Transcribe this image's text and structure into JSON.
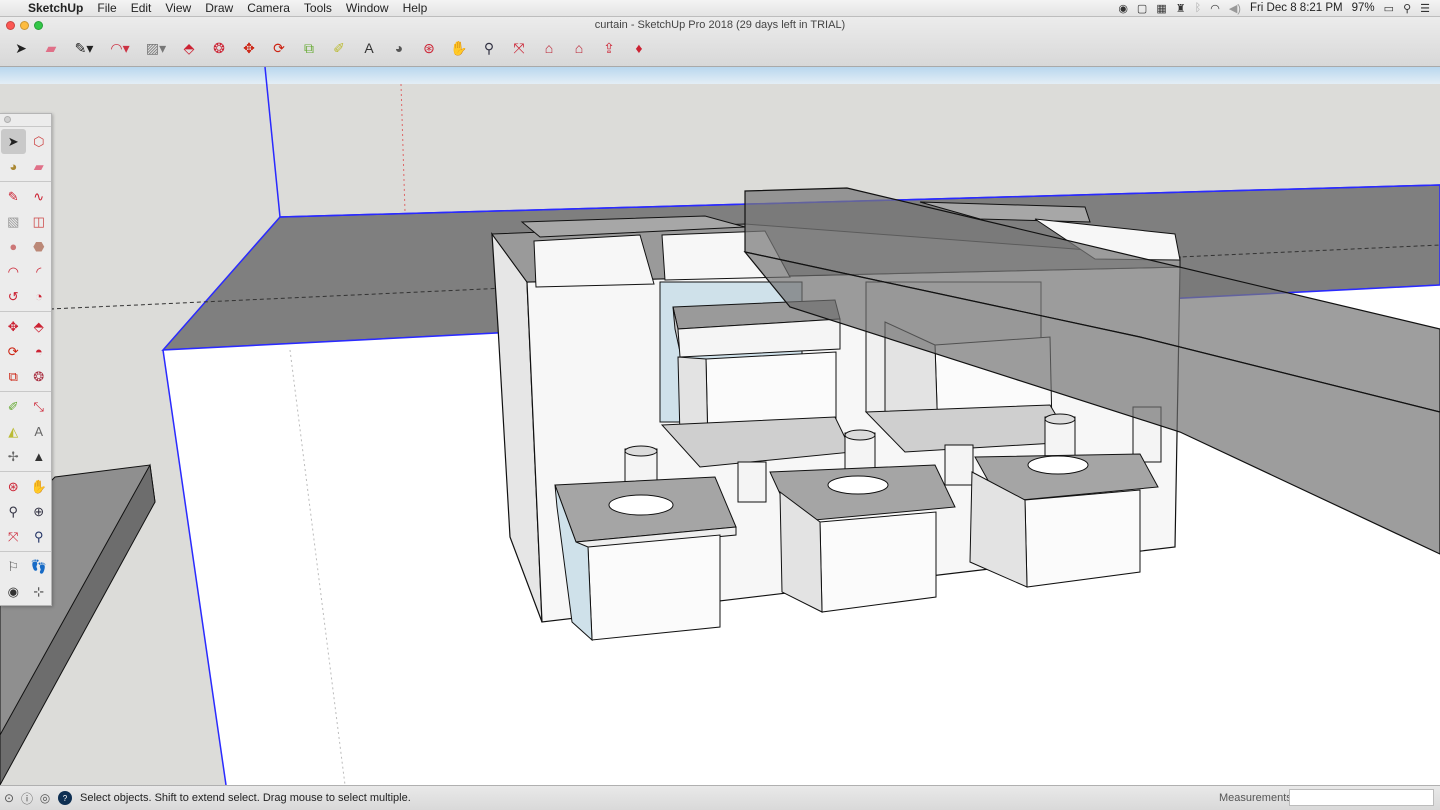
{
  "menubar": {
    "apple": "",
    "app_name": "SketchUp",
    "menus": [
      "File",
      "Edit",
      "View",
      "Draw",
      "Camera",
      "Tools",
      "Window",
      "Help"
    ],
    "status_icons": [
      "camera-icon",
      "screen-icon",
      "grid-icon",
      "binoculars-icon",
      "bluetooth-icon",
      "wifi-icon",
      "volume-icon"
    ],
    "clock": "Fri Dec 8  8:21 PM",
    "battery": "97%"
  },
  "window": {
    "title": "curtain - SketchUp Pro 2018 (29 days left in TRIAL)"
  },
  "toolbar": {
    "tools": [
      {
        "name": "select-tool-icon",
        "glyph": "➤"
      },
      {
        "name": "eraser-tool-icon",
        "glyph": "▰"
      },
      {
        "name": "line-tool-icon",
        "glyph": "✎▾"
      },
      {
        "name": "arc-tool-icon",
        "glyph": "◠▾"
      },
      {
        "name": "shape-tool-icon",
        "glyph": "▨▾"
      },
      {
        "name": "push-pull-tool-icon",
        "glyph": "⬘"
      },
      {
        "name": "offset-tool-icon",
        "glyph": "❂"
      },
      {
        "name": "move-tool-icon",
        "glyph": "✥"
      },
      {
        "name": "rotate-tool-icon",
        "glyph": "⟳"
      },
      {
        "name": "scale-tool-icon",
        "glyph": "⧉"
      },
      {
        "name": "tape-measure-tool-icon",
        "glyph": "✐"
      },
      {
        "name": "text-tool-icon",
        "glyph": "A"
      },
      {
        "name": "paint-bucket-tool-icon",
        "glyph": "◕"
      },
      {
        "name": "orbit-tool-icon",
        "glyph": "⊛"
      },
      {
        "name": "pan-tool-icon",
        "glyph": "✋"
      },
      {
        "name": "zoom-tool-icon",
        "glyph": "⚲"
      },
      {
        "name": "zoom-extents-tool-icon",
        "glyph": "⤧"
      },
      {
        "name": "warehouse-tool-icon",
        "glyph": "⌂"
      },
      {
        "name": "extension-warehouse-tool-icon",
        "glyph": "⌂"
      },
      {
        "name": "share-model-tool-icon",
        "glyph": "⇪"
      },
      {
        "name": "extension-manager-tool-icon",
        "glyph": "♦"
      }
    ]
  },
  "palette": {
    "groups": [
      [
        [
          "select-icon",
          "➤",
          true
        ],
        [
          "make-component-icon",
          "⬡",
          false
        ],
        [
          "paint-bucket-icon",
          "◕",
          false
        ],
        [
          "eraser-icon",
          "▰",
          false
        ]
      ],
      [
        [
          "line-icon",
          "✎",
          false
        ],
        [
          "freehand-icon",
          "∿",
          false
        ],
        [
          "rectangle-icon",
          "▧",
          false
        ],
        [
          "rotated-rectangle-icon",
          "◫",
          false
        ],
        [
          "circle-icon",
          "●",
          false
        ],
        [
          "polygon-icon",
          "⬣",
          false
        ],
        [
          "arc-icon",
          "◠",
          false
        ],
        [
          "two-point-arc-icon",
          "◜",
          false
        ],
        [
          "three-point-arc-icon",
          "↺",
          false
        ],
        [
          "pie-icon",
          "◔",
          false
        ]
      ],
      [
        [
          "move-icon",
          "✥",
          false
        ],
        [
          "push-pull-icon",
          "⬘",
          false
        ],
        [
          "rotate-icon",
          "⟳",
          false
        ],
        [
          "follow-me-icon",
          "◓",
          false
        ],
        [
          "scale-icon",
          "⧉",
          false
        ],
        [
          "offset-icon",
          "❂",
          false
        ]
      ],
      [
        [
          "tape-measure-icon",
          "✐",
          false
        ],
        [
          "dimension-icon",
          "⤡",
          false
        ],
        [
          "protractor-icon",
          "◭",
          false
        ],
        [
          "text-icon",
          "A",
          false
        ],
        [
          "axes-icon",
          "✢",
          false
        ],
        [
          "3d-text-icon",
          "▲",
          false
        ]
      ],
      [
        [
          "orbit-icon",
          "⊛",
          false
        ],
        [
          "pan-icon",
          "✋",
          false
        ],
        [
          "zoom-icon",
          "⚲",
          false
        ],
        [
          "zoom-window-icon",
          "⊕",
          false
        ],
        [
          "zoom-extents-icon",
          "⤧",
          false
        ],
        [
          "previous-view-icon",
          "⚲",
          false
        ]
      ],
      [
        [
          "position-camera-icon",
          "⚐",
          false
        ],
        [
          "walk-icon",
          "👣",
          false
        ],
        [
          "look-around-icon",
          "◉",
          false
        ],
        [
          "section-plane-icon",
          "⊹",
          false
        ]
      ]
    ]
  },
  "status": {
    "text": "Select objects. Shift to extend select. Drag mouse to select multiple.",
    "measurements_label": "Measurements",
    "measurements_value": ""
  }
}
